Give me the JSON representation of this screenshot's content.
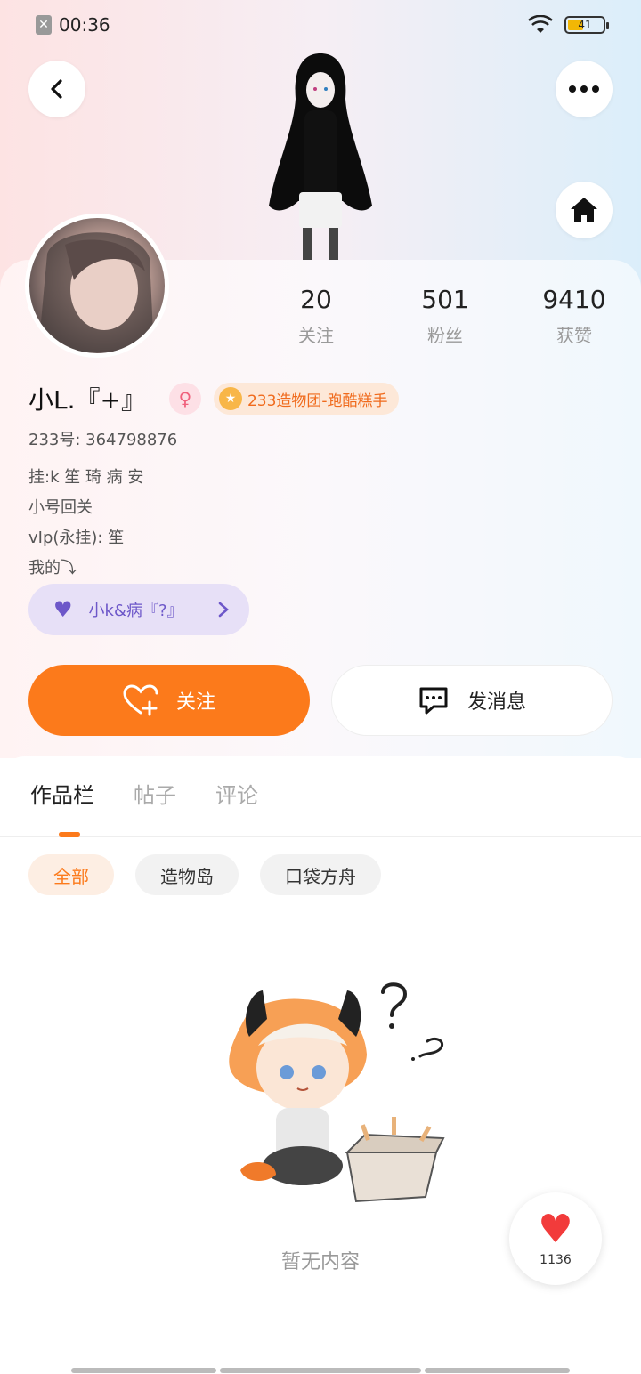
{
  "status_bar": {
    "time": "00:36",
    "battery": "41"
  },
  "profile": {
    "username": "小L.『+』",
    "gender_symbol": "♀",
    "title_badge": "233造物团-跑酷糕手",
    "uid": "233号: 364798876",
    "bio_lines": [
      "挂:k 笙 琦 病 安",
      "小号回关",
      "vIp(永挂): 笙",
      "我的⤵"
    ],
    "group_label": "小k&病『?』"
  },
  "stats": [
    {
      "value": "20",
      "label": "关注"
    },
    {
      "value": "501",
      "label": "粉丝"
    },
    {
      "value": "9410",
      "label": "获赞"
    }
  ],
  "actions": {
    "follow_label": "关注",
    "message_label": "发消息"
  },
  "tabs": [
    "作品栏",
    "帖子",
    "评论"
  ],
  "active_tab": "作品栏",
  "chips": [
    "全部",
    "造物岛",
    "口袋方舟"
  ],
  "active_chip": "全部",
  "empty_text": "暂无内容",
  "like_count": "1136",
  "colors": {
    "accent": "#fc7a1b",
    "group": "#6d57c9",
    "like": "#f23b3b"
  },
  "icons": [
    "back-icon",
    "more-icon",
    "home-icon",
    "follow-heart-plus-icon",
    "message-icon",
    "heart-icon",
    "chevron-right-icon",
    "wifi-icon",
    "battery-icon"
  ]
}
